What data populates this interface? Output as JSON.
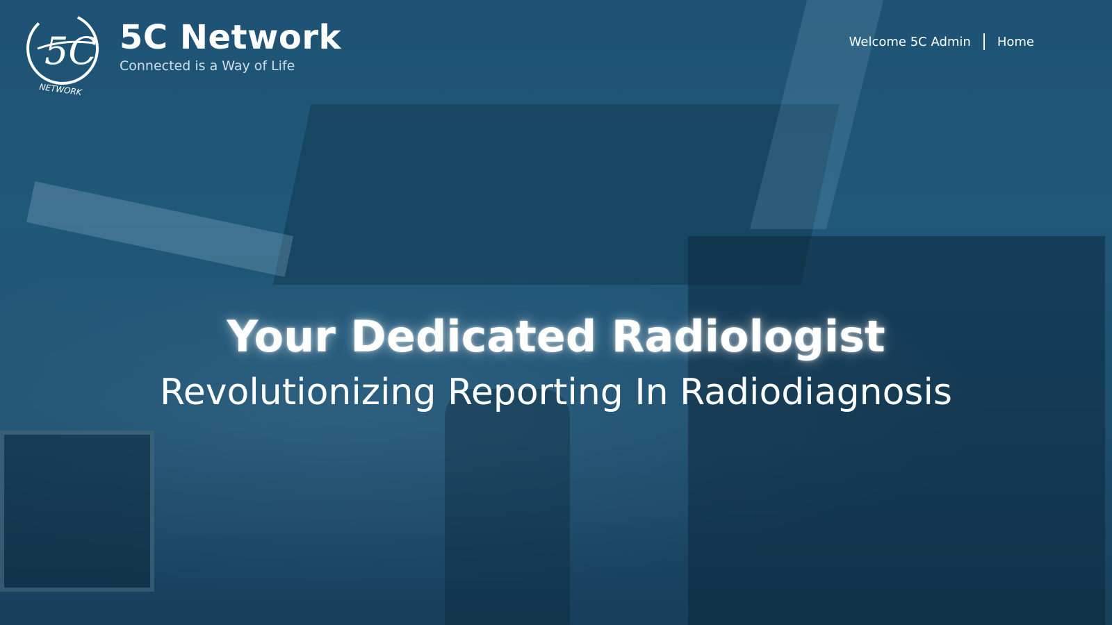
{
  "brand": {
    "name": "5C Network",
    "tagline": "Connected is a Way of Life",
    "logo_text": "NETWORK",
    "logo_mark": "5C"
  },
  "nav": {
    "welcome": "Welcome 5C Admin",
    "home": "Home"
  },
  "hero": {
    "title": "Your Dedicated Radiologist",
    "subtitle": "Revolutionizing Reporting In Radiodiagnosis"
  },
  "colors": {
    "overlay": "#1e5274",
    "text": "#ffffff",
    "tagline": "#cfe0ea"
  }
}
